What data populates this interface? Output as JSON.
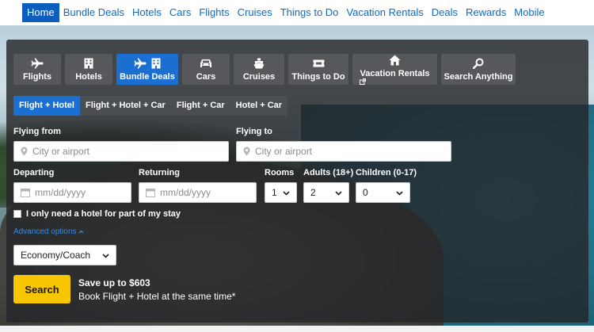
{
  "nav": {
    "items": [
      "Home",
      "Bundle Deals",
      "Hotels",
      "Cars",
      "Flights",
      "Cruises",
      "Things to Do",
      "Vacation Rentals",
      "Deals",
      "Rewards",
      "Mobile"
    ],
    "active": "Home"
  },
  "tabs": [
    {
      "label": "Flights",
      "icon": "plane-icon"
    },
    {
      "label": "Hotels",
      "icon": "hotel-icon"
    },
    {
      "label": "Bundle Deals",
      "icon": "plane-hotel-icon",
      "active": true
    },
    {
      "label": "Cars",
      "icon": "car-icon"
    },
    {
      "label": "Cruises",
      "icon": "ship-icon"
    },
    {
      "label": "Things to Do",
      "icon": "ticket-icon"
    },
    {
      "label": "Vacation Rentals",
      "icon": "house-icon",
      "external_icon": "external-link-icon"
    },
    {
      "label": "Search Anything",
      "icon": "search-icon"
    }
  ],
  "subtabs": [
    "Flight + Hotel",
    "Flight + Hotel + Car",
    "Flight + Car",
    "Hotel + Car"
  ],
  "form": {
    "flying_from_label": "Flying from",
    "flying_from_placeholder": "City or airport",
    "flying_to_label": "Flying to",
    "flying_to_placeholder": "City or airport",
    "departing_label": "Departing",
    "departing_placeholder": "mm/dd/yyyy",
    "returning_label": "Returning",
    "returning_placeholder": "mm/dd/yyyy",
    "rooms_label": "Rooms",
    "rooms_value": "1",
    "adults_label": "Adults (18+)",
    "adults_value": "2",
    "children_label": "Children (0-17)",
    "children_value": "0",
    "partial_hotel_label": "I only need a hotel for part of my stay",
    "advanced_options": "Advanced options",
    "cabin_class": "Economy/Coach",
    "search_button": "Search"
  },
  "promo": {
    "title": "Save up to $603",
    "subtitle": "Book Flight + Hotel at the same time*"
  },
  "colors": {
    "accent": "#1a6fd0",
    "search_button": "#f7c600",
    "link": "#0a6cc9"
  }
}
